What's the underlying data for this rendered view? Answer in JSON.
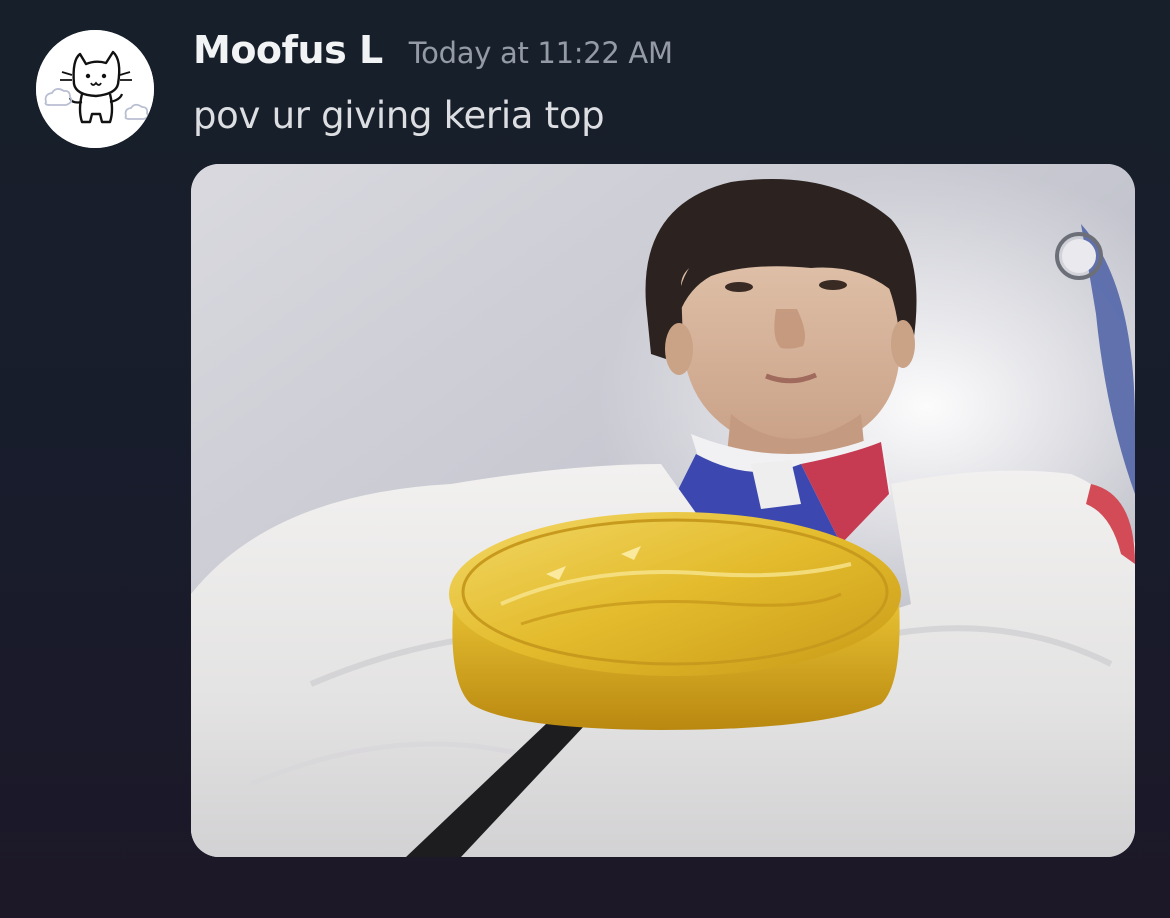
{
  "message": {
    "username": "Moofus L",
    "timestamp": "Today at 11:22 AM",
    "content": "pov ur giving keria top"
  },
  "avatar": {
    "icon": "cat-doodle-avatar"
  },
  "attachment": {
    "icon": "photo-attachment"
  },
  "colors": {
    "background": "#171e2a",
    "username": "#f2f3f5",
    "timestamp": "#959ba6",
    "content": "#dcdee2"
  }
}
